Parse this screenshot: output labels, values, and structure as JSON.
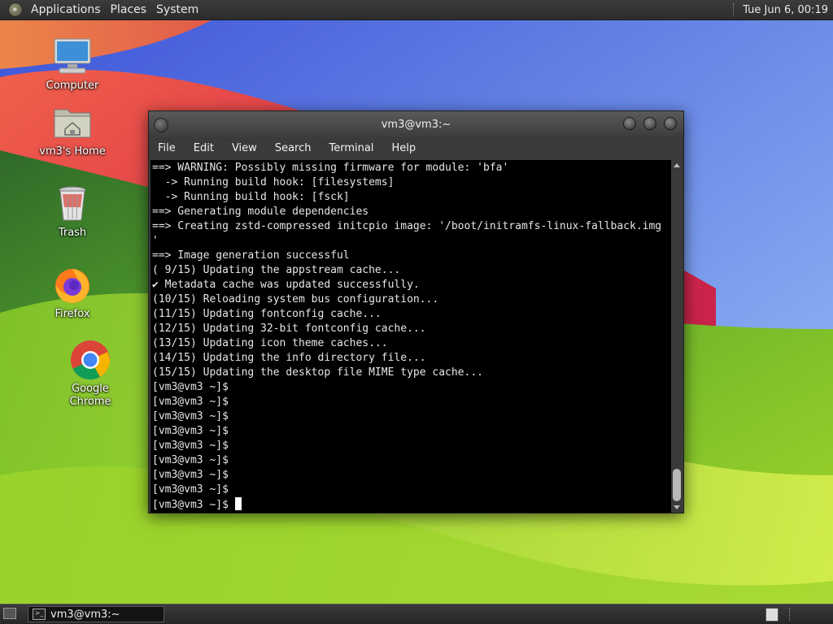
{
  "top_panel": {
    "menus": [
      "Applications",
      "Places",
      "System"
    ],
    "clock": "Tue Jun  6, 00:19"
  },
  "desktop_icons": [
    {
      "label": "Computer",
      "icon": "computer-icon"
    },
    {
      "label": "vm3's Home",
      "icon": "home-folder-icon"
    },
    {
      "label": "Trash",
      "icon": "trash-icon"
    },
    {
      "label": "Firefox",
      "icon": "firefox-icon"
    },
    {
      "label": "Google Chrome",
      "icon": "chrome-icon"
    }
  ],
  "terminal": {
    "title": "vm3@vm3:~",
    "menus": [
      "File",
      "Edit",
      "View",
      "Search",
      "Terminal",
      "Help"
    ],
    "lines": [
      "==> WARNING: Possibly missing firmware for module: 'bfa'",
      "  -> Running build hook: [filesystems]",
      "  -> Running build hook: [fsck]",
      "==> Generating module dependencies",
      "==> Creating zstd-compressed initcpio image: '/boot/initramfs-linux-fallback.img",
      "'",
      "==> Image generation successful",
      "( 9/15) Updating the appstream cache...",
      "✔ Metadata cache was updated successfully.",
      "(10/15) Reloading system bus configuration...",
      "(11/15) Updating fontconfig cache...",
      "(12/15) Updating 32-bit fontconfig cache...",
      "(13/15) Updating icon theme caches...",
      "(14/15) Updating the info directory file...",
      "(15/15) Updating the desktop file MIME type cache...",
      "[vm3@vm3 ~]$",
      "[vm3@vm3 ~]$",
      "[vm3@vm3 ~]$",
      "[vm3@vm3 ~]$",
      "[vm3@vm3 ~]$",
      "[vm3@vm3 ~]$",
      "[vm3@vm3 ~]$",
      "[vm3@vm3 ~]$"
    ],
    "prompt": "[vm3@vm3 ~]$ "
  },
  "taskbar": {
    "task_label": "vm3@vm3:~"
  }
}
